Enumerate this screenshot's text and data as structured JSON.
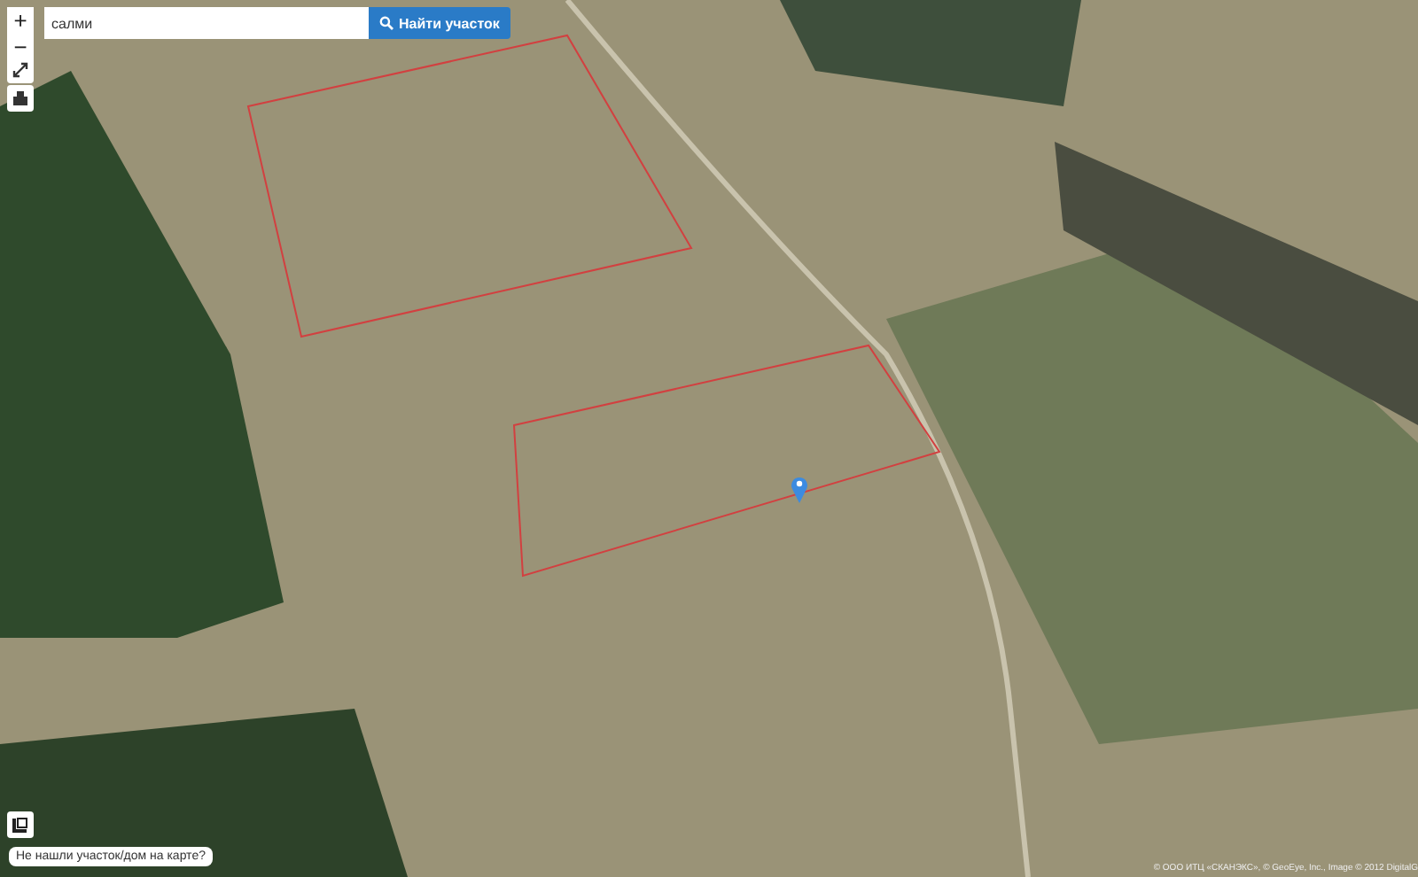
{
  "zoom_controls": {
    "zoom_in": "+",
    "zoom_out": "−"
  },
  "search": {
    "value": "салми",
    "button": "Найти участок"
  },
  "not_found_link": "Не нашли участок/дом на карте?",
  "attribution": "© ООО ИТЦ «СКАНЭКС», © GeoEye, Inc., Image © 2012 DigitalG"
}
